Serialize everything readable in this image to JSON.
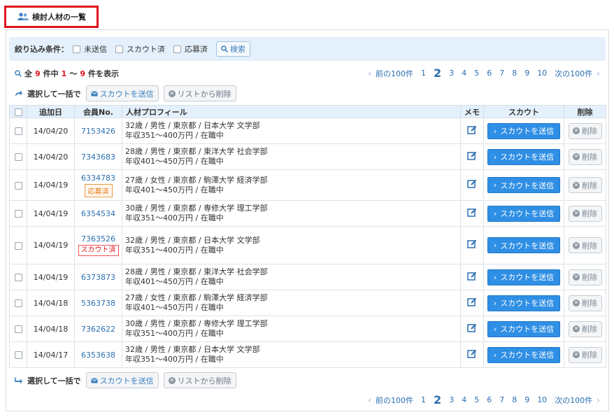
{
  "tab": {
    "label": "検討人材の一覧"
  },
  "filter": {
    "title": "絞り込み条件：",
    "options": [
      "未送信",
      "スカウト済",
      "応募済"
    ],
    "search_label": "検索"
  },
  "summary": {
    "prefix": "全",
    "total": "9",
    "mid": "件中",
    "from": "1",
    "sep": "〜",
    "to": "9",
    "suffix": "件を表示"
  },
  "pager": {
    "prev": "前の100件",
    "pages": [
      "1",
      "2",
      "3",
      "4",
      "5",
      "6",
      "7",
      "8",
      "9",
      "10"
    ],
    "current": "2",
    "next": "次の100件"
  },
  "bulk": {
    "label": "選択して一括で",
    "scout": "スカウトを送信",
    "remove": "リストから削除"
  },
  "table": {
    "headers": [
      "追加日",
      "会員No.",
      "人材プロフィール",
      "メモ",
      "スカウト",
      "削除"
    ],
    "scout_label": "スカウトを送信",
    "delete_label": "削除",
    "rows": [
      {
        "date": "14/04/20",
        "member": "7153426",
        "badge": "",
        "line1": "32歳 / 男性 / 東京都 / 日本大学 文学部",
        "line2": "年収351〜400万円 / 在職中"
      },
      {
        "date": "14/04/20",
        "member": "7343683",
        "badge": "",
        "line1": "28歳 / 男性 / 東京都 / 東洋大学 社会学部",
        "line2": "年収401〜450万円 / 在職中"
      },
      {
        "date": "14/04/19",
        "member": "6334783",
        "badge": "応募済",
        "line1": "27歳 / 女性 / 東京都 / 駒澤大学 経済学部",
        "line2": "年収401〜450万円 / 在職中"
      },
      {
        "date": "14/04/19",
        "member": "6354534",
        "badge": "",
        "line1": "30歳 / 男性 / 東京都 / 専修大学 理工学部",
        "line2": "年収351〜400万円 / 在職中"
      },
      {
        "date": "14/04/19",
        "member": "7363526",
        "badge": "スカウト済",
        "line1": "32歳 / 男性 / 東京都 / 日本大学 文学部",
        "line2": "年収351〜400万円 / 在職中"
      },
      {
        "date": "14/04/19",
        "member": "6373873",
        "badge": "",
        "line1": "28歳 / 男性 / 東京都 / 東洋大学 社会学部",
        "line2": "年収401〜450万円 / 在職中"
      },
      {
        "date": "14/04/18",
        "member": "5363738",
        "badge": "",
        "line1": "27歳 / 女性 / 東京都 / 駒澤大学 経済学部",
        "line2": "年収401〜450万円 / 在職中"
      },
      {
        "date": "14/04/18",
        "member": "7362622",
        "badge": "",
        "line1": "30歳 / 男性 / 東京都 / 専修大学 理工学部",
        "line2": "年収351〜400万円 / 在職中"
      },
      {
        "date": "14/04/17",
        "member": "6353638",
        "badge": "",
        "line1": "32歳 / 男性 / 東京都 / 日本大学 文学部",
        "line2": "年収351〜400万円 / 在職中"
      }
    ]
  },
  "colors": {
    "accent": "#2f8fe4",
    "highlight": "#e0131d",
    "header_bg": "#e4f0fb"
  }
}
